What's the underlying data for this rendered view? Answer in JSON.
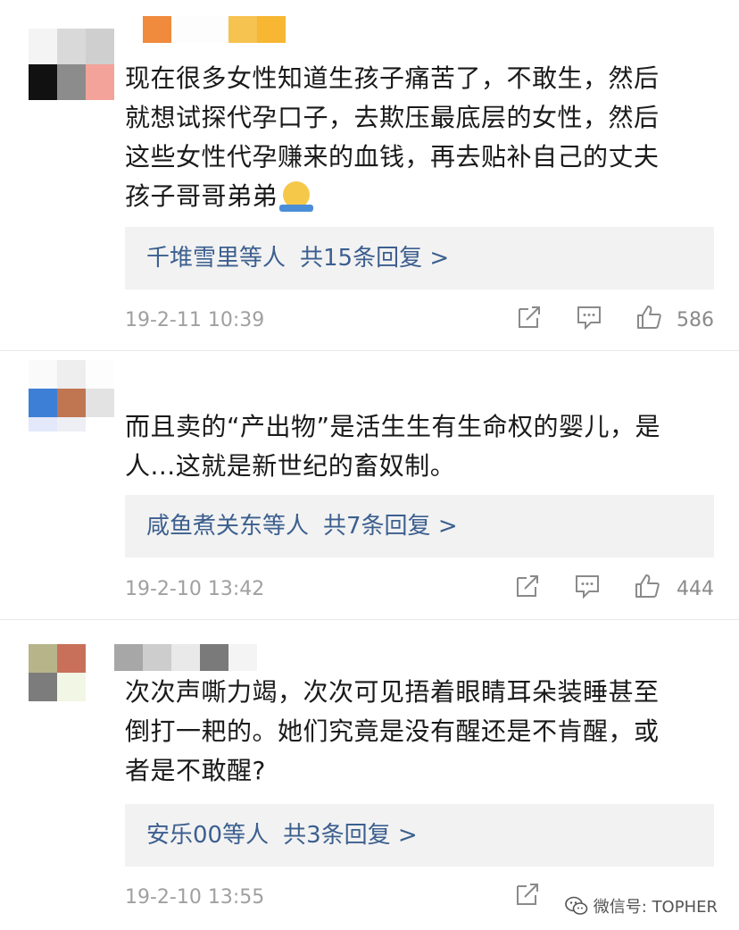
{
  "comments": [
    {
      "text_lines": [
        "现在很多女性知道生孩子痛苦了，不敢生，然后",
        "就想试探代孕口子，去欺压最底层的女性，然后",
        "这些女性代孕赚来的血钱，再去贴补自己的丈夫",
        "孩子哥哥弟弟"
      ],
      "emoji": "shrug-emoji",
      "reply": {
        "names": "千堆雪里等人",
        "count": "共15条回复 >"
      },
      "time": "19-2-11 10:39",
      "likes": "586"
    },
    {
      "text_lines": [
        "而且卖的“产出物”是活生生有生命权的婴儿，是",
        "人...这就是新世纪的畜奴制。"
      ],
      "reply": {
        "names": "咸鱼煮关东等人",
        "count": "共7条回复 >"
      },
      "time": "19-2-10 13:42",
      "likes": "444"
    },
    {
      "text_lines": [
        "次次声嘶力竭，次次可见捂着眼睛耳朵装睡甚至",
        "倒打一耙的。她们究竟是没有醒还是不肯醒，或",
        "者是不敢醒?"
      ],
      "reply": {
        "names": "安乐00等人",
        "count": "共3条回复 >"
      },
      "time": "19-2-10 13:55"
    }
  ],
  "watermark": "微信号: TOPHER",
  "icons": [
    "share-icon",
    "comment-icon",
    "thumbs-up-icon",
    "wechat-icon"
  ],
  "colors": {
    "link": "#3c5f8f",
    "meta": "#a0a0a0",
    "reply_bg": "#f2f2f2"
  }
}
